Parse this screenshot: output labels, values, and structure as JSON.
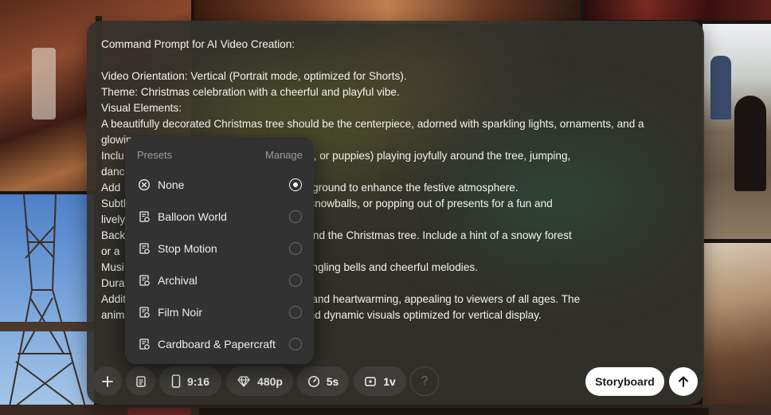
{
  "prompt": {
    "lines": [
      "Command Prompt for AI Video Creation:",
      "",
      "Video Orientation: Vertical (Portrait mode, optimized for Shorts).",
      "Theme: Christmas celebration with a cheerful and playful vibe.",
      "Visual Elements:",
      "A beautifully decorated Christmas tree should be the centerpiece, adorned with sparkling lights, ornaments, and a",
      "glowin",
      "Inclu                                  ts, squirrels, foxes, or puppies) playing joyfully around the tree, jumping,",
      "danc",
      "Add                                     lights in the background to enhance the festive atmosphere.",
      "Subtl                                   g tails, throwing snowballs, or popping out of presents for a fun and",
      "lively",
      "Backg                                   warm glow around the Christmas tree. Include a hint of a snowy forest",
      "or a",
      "Musi                                    ned music with jingling bells and cheerful melodies.",
      "Dura                                     and engaging).",
      "Addit                                   magical, festive, and heartwarming, appealing to viewers of all ages. The",
      "anim                                    e, with vibrant and dynamic visuals optimized for vertical display."
    ]
  },
  "presets": {
    "title": "Presets",
    "manage_label": "Manage",
    "items": [
      {
        "label": "None",
        "icon": "circle-x-icon",
        "selected": true
      },
      {
        "label": "Balloon World",
        "icon": "preset-style-icon",
        "selected": false
      },
      {
        "label": "Stop Motion",
        "icon": "preset-style-icon",
        "selected": false
      },
      {
        "label": "Archival",
        "icon": "preset-style-icon",
        "selected": false
      },
      {
        "label": "Film Noir",
        "icon": "preset-style-icon",
        "selected": false
      },
      {
        "label": "Cardboard & Papercraft",
        "icon": "preset-style-icon",
        "selected": false
      }
    ]
  },
  "toolbar": {
    "aspect_ratio": "9:16",
    "resolution": "480p",
    "duration": "5s",
    "variations": "1v",
    "help": "?",
    "storyboard_label": "Storyboard"
  }
}
